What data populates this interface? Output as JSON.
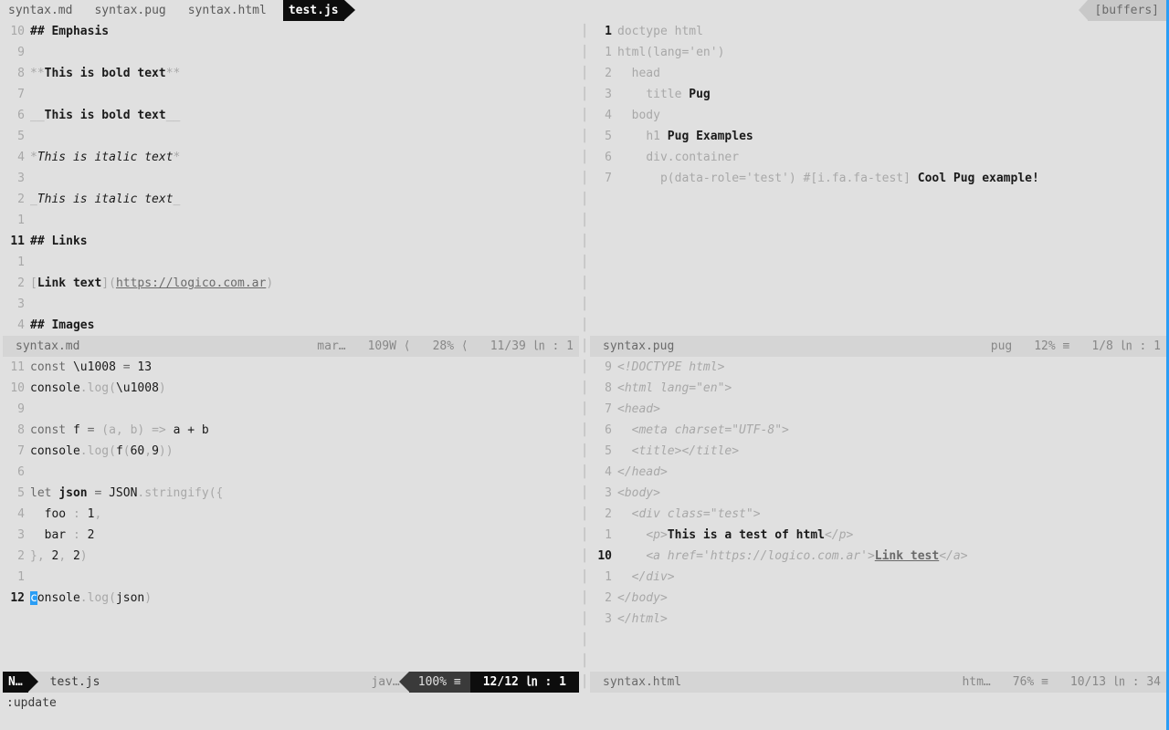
{
  "tabline": {
    "tabs": [
      "syntax.md",
      "syntax.pug",
      "syntax.html",
      "test.js"
    ],
    "active_index": 3,
    "buffers_label": "[buffers]"
  },
  "cmdline": ":update",
  "panes": {
    "md": {
      "file": "syntax.md",
      "status_meta": [
        "mar…",
        "109W ⟨",
        "28% ⟨",
        "11/39 ㏑ :  1"
      ],
      "current_line": "11",
      "lines": [
        {
          "n": "10",
          "html": "<span class='bold'>## Emphasis</span>"
        },
        {
          "n": "9",
          "html": ""
        },
        {
          "n": "8",
          "html": "<span class='dim'>**</span><span class='bold'>This is bold text</span><span class='dim'>**</span>"
        },
        {
          "n": "7",
          "html": ""
        },
        {
          "n": "6",
          "html": "<span class='dim'>__</span><span class='bold'>This is bold text</span><span class='dim'>__</span>"
        },
        {
          "n": "5",
          "html": ""
        },
        {
          "n": "4",
          "html": "<span class='dim'>*</span><span class='italic'>This is italic text</span><span class='dim'>*</span>"
        },
        {
          "n": "3",
          "html": ""
        },
        {
          "n": "2",
          "html": "<span class='dim'>_</span><span class='italic'>This is italic text</span><span class='dim'>_</span>"
        },
        {
          "n": "1",
          "html": ""
        },
        {
          "n": "11",
          "cur": true,
          "html": "<span class='bold'>## Links</span>"
        },
        {
          "n": "1",
          "html": ""
        },
        {
          "n": "2",
          "html": "<span class='dimn'>[</span><span class='bold'>Link text</span><span class='dimn'>](</span><span class='link'>https://logico.com.ar</span><span class='dimn'>)</span>"
        },
        {
          "n": "3",
          "html": ""
        },
        {
          "n": "4",
          "html": "<span class='bold'>## Images</span>"
        }
      ]
    },
    "pug": {
      "file": "syntax.pug",
      "status_meta": [
        "pug",
        "12% ≡",
        "1/8 ㏑ :  1"
      ],
      "current_line": "1",
      "lines": [
        {
          "n": "1",
          "cur": true,
          "html": "<span class='dimn'>doctype html</span>"
        },
        {
          "n": "1",
          "html": "<span class='dimn'>html(</span><span class='dimn'>lang=</span><span class='dimn'>'en'</span><span class='dimn'>)</span>"
        },
        {
          "n": "2",
          "html": "  <span class='dimn'>head</span>"
        },
        {
          "n": "3",
          "html": "    <span class='dimn'>title</span> <span class='bold'>Pug</span>"
        },
        {
          "n": "4",
          "html": "  <span class='dimn'>body</span>"
        },
        {
          "n": "5",
          "html": "    <span class='dimn'>h1</span> <span class='bold'>Pug Examples</span>"
        },
        {
          "n": "6",
          "html": "    <span class='dimn'>div.container</span>"
        },
        {
          "n": "7",
          "html": "      <span class='dimn'>p(</span><span class='dimn'>data-role='test'</span><span class='dimn'>)</span> <span class='dimn'>#[</span><span class='dimn'>i.fa.fa-test</span><span class='dimn'>]</span> <span class='bold'>Cool Pug example!</span>"
        }
      ]
    },
    "js": {
      "file": "test.js",
      "mode_label": "N…",
      "ft_label": "jav…",
      "pct_label": "100% ≡",
      "pos_label": "12/12 ㏑ :  1",
      "current_line": "12",
      "lines": [
        {
          "n": "11",
          "html": "<span class='mono'>const </span>\\u1008 <span class='mono'>=</span> 13"
        },
        {
          "n": "10",
          "html": "console<span class='dimn'>.log(</span>\\u1008<span class='dimn'>)</span>"
        },
        {
          "n": "9",
          "html": ""
        },
        {
          "n": "8",
          "html": "<span class='mono'>const </span>f <span class='mono'>=</span> <span class='dimn'>(a, b) =&gt; </span>a + b"
        },
        {
          "n": "7",
          "html": "console<span class='dimn'>.log(</span>f<span class='dimn'>(</span>60<span class='dimn'>,</span>9<span class='dimn'>))</span>"
        },
        {
          "n": "6",
          "html": ""
        },
        {
          "n": "5",
          "html": "<span class='mono'>let </span><span class='bold'>json</span> <span class='mono'>=</span> JSON<span class='dimn'>.stringify({</span>"
        },
        {
          "n": "4",
          "html": "  foo <span class='dimn'>:</span> 1<span class='dimn'>,</span>"
        },
        {
          "n": "3",
          "html": "  bar <span class='dimn'>:</span> 2"
        },
        {
          "n": "2",
          "html": "<span class='dimn'>}, </span>2<span class='dimn'>, </span>2<span class='dimn'>)</span>"
        },
        {
          "n": "1",
          "html": ""
        },
        {
          "n": "12",
          "cur": true,
          "html": "<span class='cursor'>c</span>onsole<span class='dimn'>.log(</span>json<span class='dimn'>)</span>"
        }
      ]
    },
    "html": {
      "file": "syntax.html",
      "status_meta": [
        "htm…",
        "76% ≡",
        "10/13 ㏑ : 34"
      ],
      "current_line": "10",
      "lines": [
        {
          "n": "9",
          "html": "<span class='htmlt'>&lt;!DOCTYPE html&gt;</span>"
        },
        {
          "n": "8",
          "html": "<span class='htmlt'>&lt;html lang=\"en\"&gt;</span>"
        },
        {
          "n": "7",
          "html": "<span class='htmlt'>&lt;head&gt;</span>"
        },
        {
          "n": "6",
          "html": "  <span class='htmlt'>&lt;meta charset=\"UTF-8\"&gt;</span>"
        },
        {
          "n": "5",
          "html": "  <span class='htmlt'>&lt;title&gt;&lt;/title&gt;</span>"
        },
        {
          "n": "4",
          "html": "<span class='htmlt'>&lt;/head&gt;</span>"
        },
        {
          "n": "3",
          "html": "<span class='htmlt'>&lt;body&gt;</span>"
        },
        {
          "n": "2",
          "html": "  <span class='htmlt'>&lt;div class=\"test\"&gt;</span>"
        },
        {
          "n": "1",
          "html": "    <span class='htmlt'>&lt;p&gt;</span><span class='bold'>This is a test of html</span><span class='htmlt'>&lt;/p&gt;</span>"
        },
        {
          "n": "10",
          "cur": true,
          "html": "    <span class='htmlt'>&lt;a href='https://logico.com.ar'&gt;</span><span class='link bold'>Link test</span><span class='htmlt'>&lt;/a&gt;</span>"
        },
        {
          "n": "1",
          "html": "  <span class='htmlt'>&lt;/div&gt;</span>"
        },
        {
          "n": "2",
          "html": "<span class='htmlt'>&lt;/body&gt;</span>"
        },
        {
          "n": "3",
          "html": "<span class='htmlt'>&lt;/html&gt;</span>"
        }
      ]
    }
  }
}
